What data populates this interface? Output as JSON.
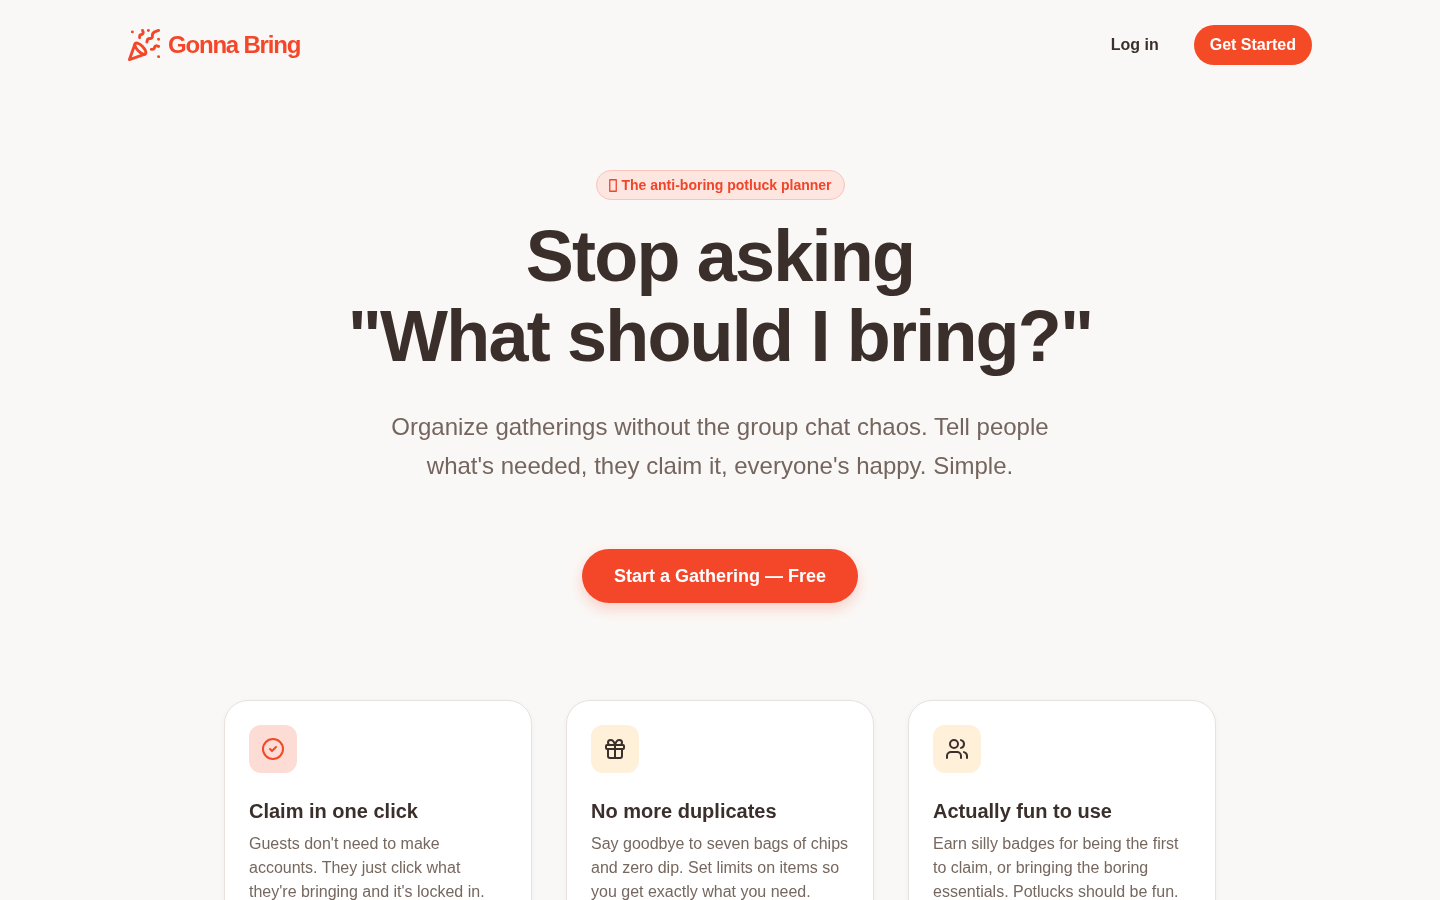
{
  "header": {
    "logo": {
      "text": "Gonna Bring"
    },
    "nav": [
      {
        "label": "Log in",
        "kind": "link"
      },
      {
        "label": "Get Started",
        "kind": "primary"
      }
    ]
  },
  "hero": {
    "badge": "The anti-boring potluck planner",
    "headline_lines": [
      "Stop asking",
      "\"What should I bring?\""
    ],
    "subtitle": "Organize gatherings without the group chat chaos. Tell people what's needed, they claim it, everyone's happy. Simple.",
    "cta": "Start a Gathering — Free"
  },
  "features": [
    {
      "kind": "check",
      "color": "#fddcd6",
      "title": "Claim in one click",
      "description": "Guests don't need to make accounts. They just click what they're bringing and it's locked in."
    },
    {
      "kind": "gift",
      "color": "#fef0d9",
      "title": "No more duplicates",
      "description": "Say goodbye to seven bags of chips and zero dip. Set limits on items so you get exactly what you need."
    },
    {
      "kind": "users",
      "color": "#fef0d9",
      "title": "Actually fun to use",
      "description": "Earn silly badges for being the first to claim, or bringing the boring essentials. Potlucks should be fun."
    }
  ]
}
